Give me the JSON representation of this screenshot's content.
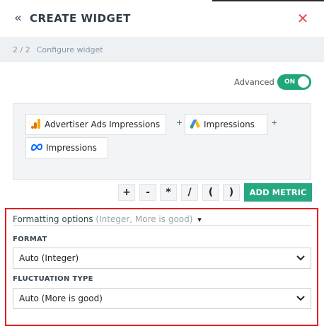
{
  "header": {
    "title": "CREATE WIDGET",
    "back_icon": "double-chevron-left-icon",
    "close_icon": "close-icon"
  },
  "stepbar": {
    "step": "2 / 2",
    "label": "Configure widget"
  },
  "advanced": {
    "label": "Advanced",
    "toggle_text": "ON",
    "enabled": true
  },
  "metrics": [
    {
      "label": "Advertiser Ads Impressions",
      "icon": "google-analytics-icon"
    },
    {
      "label": "Impressions",
      "icon": "google-ads-icon"
    },
    {
      "label": "Impressions",
      "icon": "meta-icon"
    }
  ],
  "metric_joiner": "+",
  "operators": [
    "+",
    "-",
    "*",
    "/",
    "(",
    ")"
  ],
  "add_metric_label": "ADD METRIC",
  "formatting": {
    "title": "Formatting options",
    "summary": "(Integer, More is good)",
    "format_label": "FORMAT",
    "format_value": "Auto (Integer)",
    "fluctuation_label": "FLUCTUATION TYPE",
    "fluctuation_value": "Auto (More is good)"
  },
  "colors": {
    "accent": "#26a882",
    "toggle": "#1fa67a",
    "close": "#e05050",
    "highlight_border": "#e02020"
  }
}
